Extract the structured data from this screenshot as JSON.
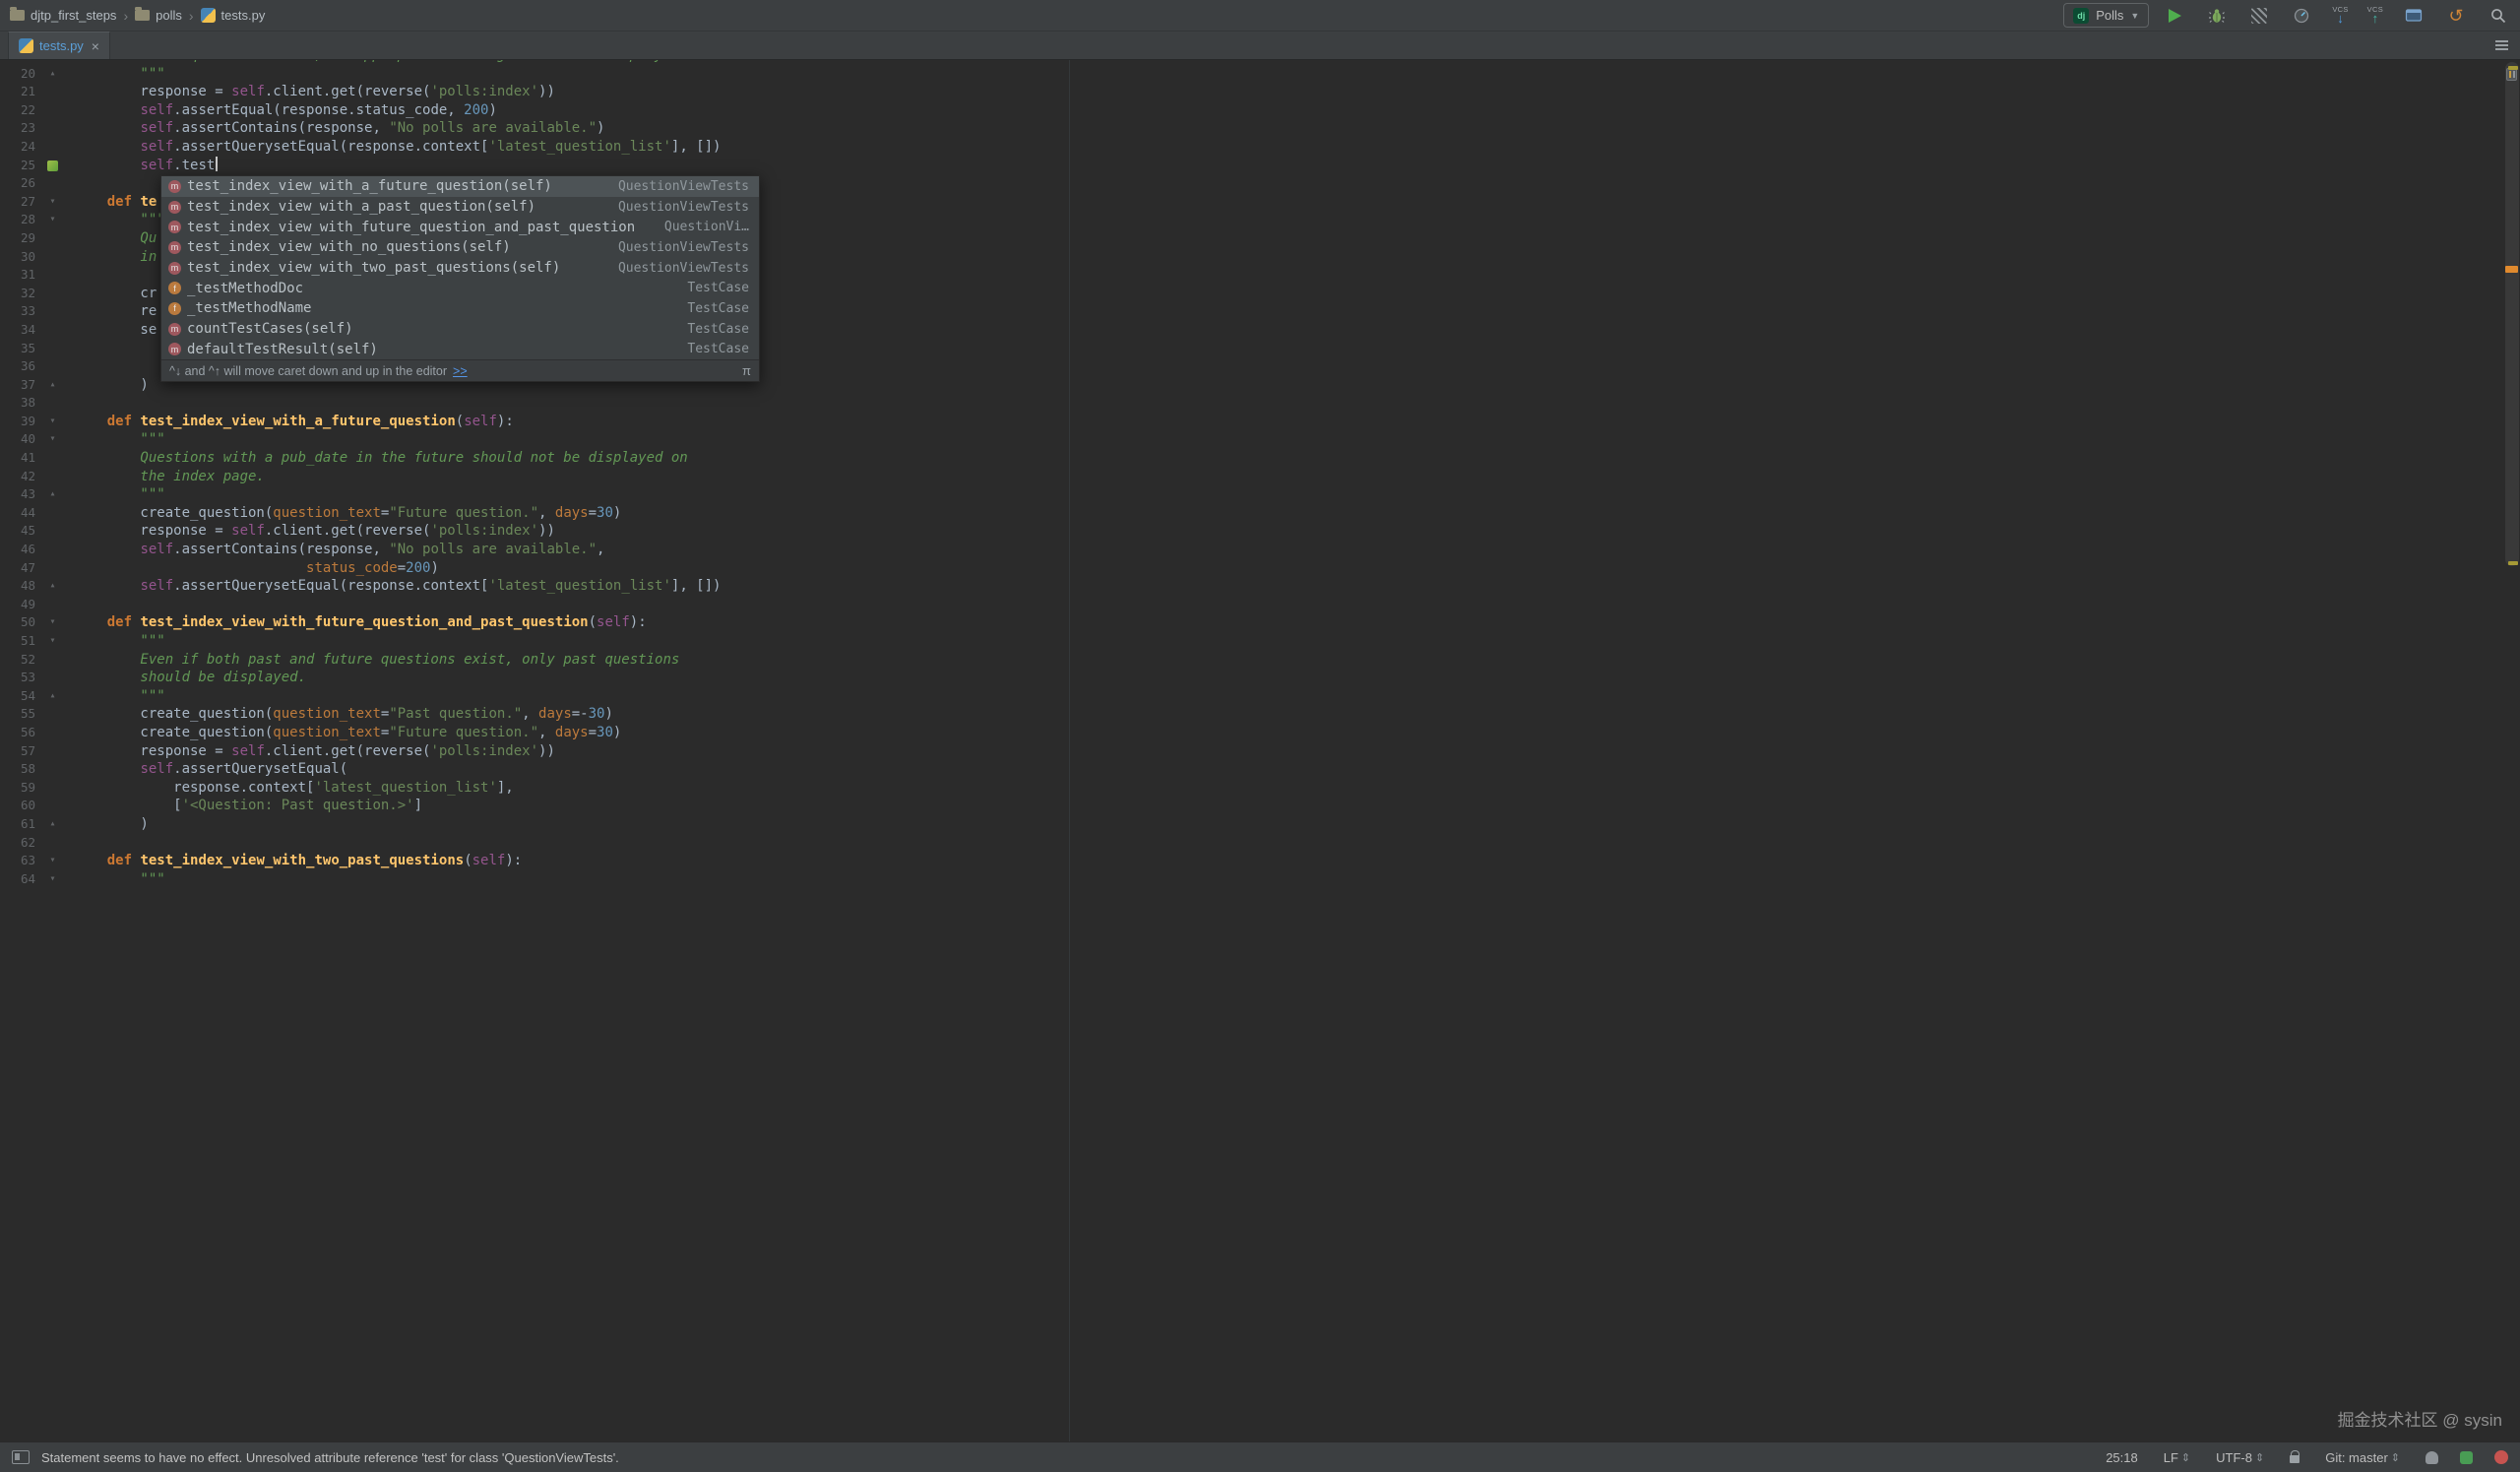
{
  "breadcrumbs": [
    "djtp_first_steps",
    "polls",
    "tests.py"
  ],
  "tab": {
    "label": "tests.py"
  },
  "toolbar": {
    "run_config": "Polls",
    "django_badge": "dj",
    "vcs_label": "VCS",
    "icons": [
      "run",
      "debug",
      "coverage",
      "profiler",
      "vcs-update",
      "vcs-commit",
      "changes",
      "rollback",
      "search"
    ]
  },
  "editor": {
    "colors": {
      "background": "#2b2b2b",
      "keyword": "#cc7832",
      "string": "#6a8759",
      "docstring": "#629755",
      "number": "#6897bb",
      "self": "#94558d",
      "function": "#ffc66d",
      "default": "#a9b7c6"
    },
    "lines": [
      {
        "n": "",
        "seg": [
          [
            "ds",
            "        If no questions exist, an appropriate message should be displayed."
          ]
        ]
      },
      {
        "n": 20,
        "fold": "up",
        "seg": [
          [
            "ds",
            "        \"\"\""
          ]
        ]
      },
      {
        "n": 21,
        "seg": [
          [
            "d",
            "        response = "
          ],
          [
            "sf",
            "self"
          ],
          [
            "d",
            ".client.get(reverse("
          ],
          [
            "s",
            "'polls:index'"
          ],
          [
            "d",
            "))"
          ]
        ]
      },
      {
        "n": 22,
        "seg": [
          [
            "d",
            "        "
          ],
          [
            "sf",
            "self"
          ],
          [
            "d",
            ".assertEqual(response.status_code, "
          ],
          [
            "n2",
            "200"
          ],
          [
            "d",
            ")"
          ]
        ]
      },
      {
        "n": 23,
        "seg": [
          [
            "d",
            "        "
          ],
          [
            "sf",
            "self"
          ],
          [
            "d",
            ".assertContains(response, "
          ],
          [
            "s",
            "\"No polls are available.\""
          ],
          [
            "d",
            ")"
          ]
        ]
      },
      {
        "n": 24,
        "seg": [
          [
            "d",
            "        "
          ],
          [
            "sf",
            "self"
          ],
          [
            "d",
            ".assertQuerysetEqual(response.context["
          ],
          [
            "s",
            "'latest_question_list'"
          ],
          [
            "d",
            "], [])"
          ]
        ]
      },
      {
        "n": 25,
        "marker": "green",
        "caret": true,
        "seg": [
          [
            "d",
            "        "
          ],
          [
            "sf",
            "self"
          ],
          [
            "d",
            ".test"
          ]
        ]
      },
      {
        "n": 26,
        "seg": []
      },
      {
        "n": 27,
        "fold": "down",
        "seg": [
          [
            "d",
            "    "
          ],
          [
            "k",
            "def"
          ],
          [
            "d",
            " "
          ],
          [
            "fn",
            "te"
          ]
        ]
      },
      {
        "n": 28,
        "fold": "down",
        "seg": [
          [
            "ds",
            "        \"\"\""
          ]
        ]
      },
      {
        "n": 29,
        "seg": [
          [
            "ds",
            "        Qu"
          ]
        ]
      },
      {
        "n": 30,
        "seg": [
          [
            "ds",
            "        in"
          ]
        ]
      },
      {
        "n": 31,
        "seg": []
      },
      {
        "n": 32,
        "seg": [
          [
            "d",
            "        cr"
          ]
        ]
      },
      {
        "n": 33,
        "seg": [
          [
            "d",
            "        re"
          ]
        ]
      },
      {
        "n": 34,
        "seg": [
          [
            "d",
            "        se"
          ]
        ]
      },
      {
        "n": 35,
        "seg": []
      },
      {
        "n": 36,
        "seg": []
      },
      {
        "n": 37,
        "fold": "up",
        "seg": [
          [
            "d",
            "        )"
          ]
        ]
      },
      {
        "n": 38,
        "seg": []
      },
      {
        "n": 39,
        "fold": "down",
        "seg": [
          [
            "d",
            "    "
          ],
          [
            "k",
            "def"
          ],
          [
            "d",
            " "
          ],
          [
            "fn",
            "test_index_view_with_a_future_question"
          ],
          [
            "d",
            "("
          ],
          [
            "sf",
            "self"
          ],
          [
            "d",
            "):"
          ]
        ]
      },
      {
        "n": 40,
        "fold": "down",
        "seg": [
          [
            "ds",
            "        \"\"\""
          ]
        ]
      },
      {
        "n": 41,
        "seg": [
          [
            "ds",
            "        Questions with a pub_date in the future should not be displayed on"
          ]
        ]
      },
      {
        "n": 42,
        "seg": [
          [
            "ds",
            "        the index page."
          ]
        ]
      },
      {
        "n": 43,
        "fold": "up",
        "seg": [
          [
            "ds",
            "        \"\"\""
          ]
        ]
      },
      {
        "n": 44,
        "seg": [
          [
            "d",
            "        create_question("
          ],
          [
            "kw",
            "question_text"
          ],
          [
            "d",
            "="
          ],
          [
            "s",
            "\"Future question.\""
          ],
          [
            "d",
            ", "
          ],
          [
            "kw",
            "days"
          ],
          [
            "d",
            "="
          ],
          [
            "n2",
            "30"
          ],
          [
            "d",
            ")"
          ]
        ]
      },
      {
        "n": 45,
        "seg": [
          [
            "d",
            "        response = "
          ],
          [
            "sf",
            "self"
          ],
          [
            "d",
            ".client.get(reverse("
          ],
          [
            "s",
            "'polls:index'"
          ],
          [
            "d",
            "))"
          ]
        ]
      },
      {
        "n": 46,
        "seg": [
          [
            "d",
            "        "
          ],
          [
            "sf",
            "self"
          ],
          [
            "d",
            ".assertContains(response, "
          ],
          [
            "s",
            "\"No polls are available.\""
          ],
          [
            "d",
            ","
          ]
        ]
      },
      {
        "n": 47,
        "seg": [
          [
            "d",
            "                            "
          ],
          [
            "kw",
            "status_code"
          ],
          [
            "d",
            "="
          ],
          [
            "n2",
            "200"
          ],
          [
            "d",
            ")"
          ]
        ]
      },
      {
        "n": 48,
        "fold": "up",
        "seg": [
          [
            "d",
            "        "
          ],
          [
            "sf",
            "self"
          ],
          [
            "d",
            ".assertQuerysetEqual(response.context["
          ],
          [
            "s",
            "'latest_question_list'"
          ],
          [
            "d",
            "], [])"
          ]
        ]
      },
      {
        "n": 49,
        "seg": []
      },
      {
        "n": 50,
        "fold": "down",
        "seg": [
          [
            "d",
            "    "
          ],
          [
            "k",
            "def"
          ],
          [
            "d",
            " "
          ],
          [
            "fn",
            "test_index_view_with_future_question_and_past_question"
          ],
          [
            "d",
            "("
          ],
          [
            "sf",
            "self"
          ],
          [
            "d",
            "):"
          ]
        ]
      },
      {
        "n": 51,
        "fold": "down",
        "seg": [
          [
            "ds",
            "        \"\"\""
          ]
        ]
      },
      {
        "n": 52,
        "seg": [
          [
            "ds",
            "        Even if both past and future questions exist, only past questions"
          ]
        ]
      },
      {
        "n": 53,
        "seg": [
          [
            "ds",
            "        should be displayed."
          ]
        ]
      },
      {
        "n": 54,
        "fold": "up",
        "seg": [
          [
            "ds",
            "        \"\"\""
          ]
        ]
      },
      {
        "n": 55,
        "seg": [
          [
            "d",
            "        create_question("
          ],
          [
            "kw",
            "question_text"
          ],
          [
            "d",
            "="
          ],
          [
            "s",
            "\"Past question.\""
          ],
          [
            "d",
            ", "
          ],
          [
            "kw",
            "days"
          ],
          [
            "d",
            "=-"
          ],
          [
            "n2",
            "30"
          ],
          [
            "d",
            ")"
          ]
        ]
      },
      {
        "n": 56,
        "seg": [
          [
            "d",
            "        create_question("
          ],
          [
            "kw",
            "question_text"
          ],
          [
            "d",
            "="
          ],
          [
            "s",
            "\"Future question.\""
          ],
          [
            "d",
            ", "
          ],
          [
            "kw",
            "days"
          ],
          [
            "d",
            "="
          ],
          [
            "n2",
            "30"
          ],
          [
            "d",
            ")"
          ]
        ]
      },
      {
        "n": 57,
        "seg": [
          [
            "d",
            "        response = "
          ],
          [
            "sf",
            "self"
          ],
          [
            "d",
            ".client.get(reverse("
          ],
          [
            "s",
            "'polls:index'"
          ],
          [
            "d",
            "))"
          ]
        ]
      },
      {
        "n": 58,
        "seg": [
          [
            "d",
            "        "
          ],
          [
            "sf",
            "self"
          ],
          [
            "d",
            ".assertQuerysetEqual("
          ]
        ]
      },
      {
        "n": 59,
        "seg": [
          [
            "d",
            "            response.context["
          ],
          [
            "s",
            "'latest_question_list'"
          ],
          [
            "d",
            "],"
          ]
        ]
      },
      {
        "n": 60,
        "seg": [
          [
            "d",
            "            ["
          ],
          [
            "s",
            "'<Question: Past question.>'"
          ],
          [
            "d",
            "]"
          ]
        ]
      },
      {
        "n": 61,
        "fold": "up",
        "seg": [
          [
            "d",
            "        )"
          ]
        ]
      },
      {
        "n": 62,
        "seg": []
      },
      {
        "n": 63,
        "fold": "down",
        "seg": [
          [
            "d",
            "    "
          ],
          [
            "k",
            "def"
          ],
          [
            "d",
            " "
          ],
          [
            "fn",
            "test_index_view_with_two_past_questions"
          ],
          [
            "d",
            "("
          ],
          [
            "sf",
            "self"
          ],
          [
            "d",
            "):"
          ]
        ]
      },
      {
        "n": 64,
        "fold": "down",
        "seg": [
          [
            "ds",
            "        \"\"\""
          ]
        ]
      }
    ]
  },
  "popup": {
    "items": [
      {
        "icon": "m",
        "name": "test_index_view_with_a_future_question(self)",
        "place": "QuestionViewTests",
        "selected": true
      },
      {
        "icon": "m",
        "name": "test_index_view_with_a_past_question(self)",
        "place": "QuestionViewTests"
      },
      {
        "icon": "m",
        "name": "test_index_view_with_future_question_and_past_question",
        "place": "QuestionVi…"
      },
      {
        "icon": "m",
        "name": "test_index_view_with_no_questions(self)",
        "place": "QuestionViewTests"
      },
      {
        "icon": "m",
        "name": "test_index_view_with_two_past_questions(self)",
        "place": "QuestionViewTests"
      },
      {
        "icon": "f",
        "name": "_testMethodDoc",
        "place": "TestCase"
      },
      {
        "icon": "f",
        "name": "_testMethodName",
        "place": "TestCase"
      },
      {
        "icon": "m",
        "name": "countTestCases(self)",
        "place": "TestCase"
      },
      {
        "icon": "m",
        "name": "defaultTestResult(self)",
        "place": "TestCase"
      }
    ],
    "hint": "^↓ and ^↑ will move caret down and up in the editor",
    "hint_link": ">>",
    "hint_symbol": "π"
  },
  "status_bar": {
    "message": "Statement seems to have no effect. Unresolved attribute reference 'test' for class 'QuestionViewTests'.",
    "position": "25:18",
    "line_ending": "LF",
    "encoding": "UTF-8",
    "git_branch": "Git: master"
  },
  "watermark": "掘金技术社区 @ sysin"
}
